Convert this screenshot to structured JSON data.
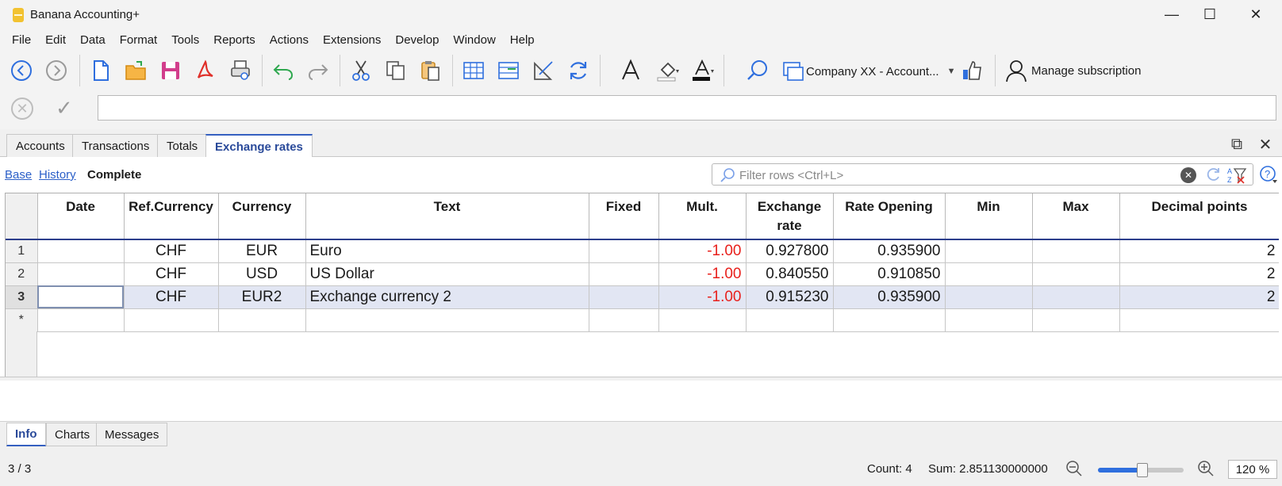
{
  "window": {
    "title": "Banana Accounting+",
    "minimize_icon": "minimize-icon",
    "maximize_icon": "maximize-icon",
    "close_icon": "close-icon"
  },
  "menu": [
    "File",
    "Edit",
    "Data",
    "Format",
    "Tools",
    "Reports",
    "Actions",
    "Extensions",
    "Develop",
    "Window",
    "Help"
  ],
  "toolbar": {
    "company": "Company XX - Account...",
    "manage_subscription": "Manage subscription",
    "accent": "#2f6fde"
  },
  "edit_bar": {
    "value": ""
  },
  "tabs": [
    "Accounts",
    "Transactions",
    "Totals",
    "Exchange rates"
  ],
  "active_tab": "Exchange rates",
  "views": {
    "base": "Base",
    "history": "History",
    "complete": "Complete"
  },
  "filter": {
    "placeholder": "Filter rows <Ctrl+L>"
  },
  "table": {
    "headers": {
      "date": "Date",
      "ref_currency": "Ref.Currency",
      "currency": "Currency",
      "text": "Text",
      "fixed": "Fixed",
      "mult": "Mult.",
      "exchange_rate_1": "Exchange",
      "exchange_rate_2": "rate",
      "rate_opening": "Rate Opening",
      "min": "Min",
      "max": "Max",
      "decimal_points": "Decimal points"
    },
    "rows": [
      {
        "num": "1",
        "date": "",
        "ref": "CHF",
        "currency": "EUR",
        "text": "Euro",
        "fixed": "",
        "mult": "-1.00",
        "rate": "0.927800",
        "opening": "0.935900",
        "min": "",
        "max": "",
        "decimals": "2"
      },
      {
        "num": "2",
        "date": "",
        "ref": "CHF",
        "currency": "USD",
        "text": "US Dollar",
        "fixed": "",
        "mult": "-1.00",
        "rate": "0.840550",
        "opening": "0.910850",
        "min": "",
        "max": "",
        "decimals": "2"
      },
      {
        "num": "3",
        "date": "",
        "ref": "CHF",
        "currency": "EUR2",
        "text": "Exchange currency 2",
        "fixed": "",
        "mult": "-1.00",
        "rate": "0.915230",
        "opening": "0.935900",
        "min": "",
        "max": "",
        "decimals": "2"
      }
    ],
    "new_row_marker": "*"
  },
  "bottom_tabs": [
    "Info",
    "Charts",
    "Messages"
  ],
  "status": {
    "position": "3 / 3",
    "count": "Count: 4",
    "sum": "Sum: 2.851130000000",
    "zoom": "120 %",
    "zoom_slider_level": 0.52
  }
}
